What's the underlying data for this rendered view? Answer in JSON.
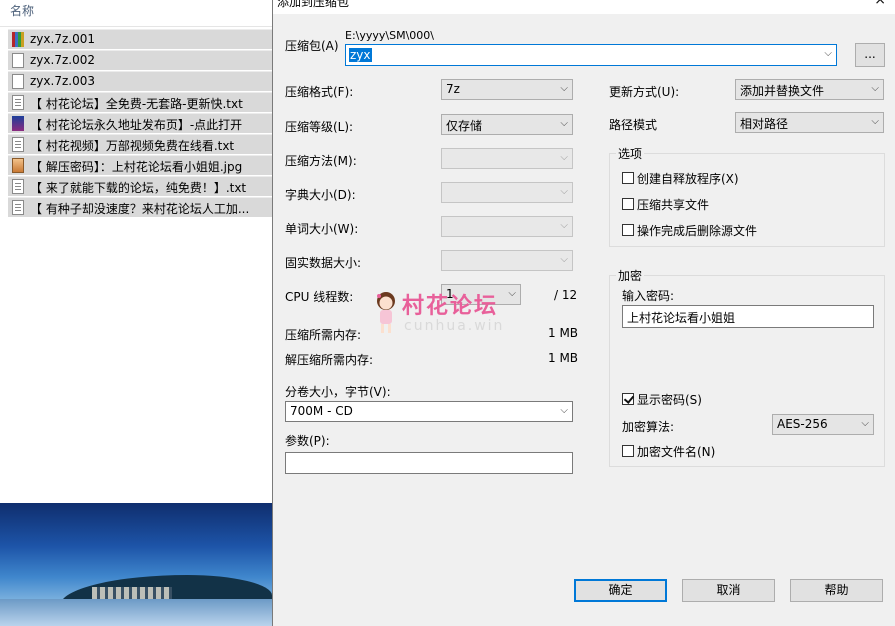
{
  "explorer": {
    "column_header": "名称",
    "files": [
      {
        "name": "zyx.7z.001",
        "icon": "winrar-archive-icon"
      },
      {
        "name": "zyx.7z.002",
        "icon": "blank-file-icon"
      },
      {
        "name": "zyx.7z.003",
        "icon": "blank-file-icon"
      },
      {
        "name": "【 村花论坛】全免费-无套路-更新快.txt",
        "icon": "text-file-icon"
      },
      {
        "name": "【 村花论坛永久地址发布页】-点此打开",
        "icon": "html-file-icon"
      },
      {
        "name": "【 村花视频】万部视频免费在线看.txt",
        "icon": "text-file-icon"
      },
      {
        "name": "【 解压密码】：上村花论坛看小姐姐.jpg",
        "icon": "image-file-icon"
      },
      {
        "name": "【 来了就能下载的论坛，纯免费！】.txt",
        "icon": "text-file-icon"
      },
      {
        "name": "【 有种子却没速度？来村花论坛人工加...",
        "icon": "text-file-icon"
      }
    ]
  },
  "dialog": {
    "title": "添加到压缩包",
    "close": "×",
    "archive_label": "压缩包(A)",
    "archive_path": "E:\\yyyy\\SM\\000\\",
    "archive_name": "zyx",
    "browse_label": "...",
    "format_label": "压缩格式(F):",
    "format_value": "7z",
    "level_label": "压缩等级(L):",
    "level_value": "仅存储",
    "method_label": "压缩方法(M):",
    "method_value": "",
    "dict_label": "字典大小(D):",
    "dict_value": "",
    "word_label": "单词大小(W):",
    "word_value": "",
    "solid_label": "固实数据大小:",
    "solid_value": "",
    "cpu_label": "CPU 线程数:",
    "cpu_value": "1",
    "cpu_max": "/ 12",
    "mem_compress_label": "压缩所需内存:",
    "mem_compress_value": "1 MB",
    "mem_decompress_label": "解压缩所需内存:",
    "mem_decompress_value": "1 MB",
    "volume_label": "分卷大小，字节(V):",
    "volume_value": "700M - CD",
    "params_label": "参数(P):",
    "params_value": "",
    "update_label": "更新方式(U):",
    "update_value": "添加并替换文件",
    "pathmode_label": "路径模式",
    "pathmode_value": "相对路径",
    "options_title": "选项",
    "opt_sfx": "创建自释放程序(X)",
    "opt_shared": "压缩共享文件",
    "opt_delete": "操作完成后删除源文件",
    "encryption_title": "加密",
    "password_label": "输入密码:",
    "password_value": "上村花论坛看小姐姐",
    "show_password": "显示密码(S)",
    "enc_method_label": "加密算法:",
    "enc_method_value": "AES-256",
    "encrypt_names": "加密文件名(N)",
    "ok": "确定",
    "cancel": "取消",
    "help": "帮助"
  },
  "watermark": {
    "text": "村花论坛",
    "sub": "cunhua.win"
  },
  "colors": {
    "accent": "#0078d7",
    "dialog_bg": "#f0f0f0",
    "selection_row": "#d9d9d9",
    "watermark_pink": "#e8609a"
  }
}
